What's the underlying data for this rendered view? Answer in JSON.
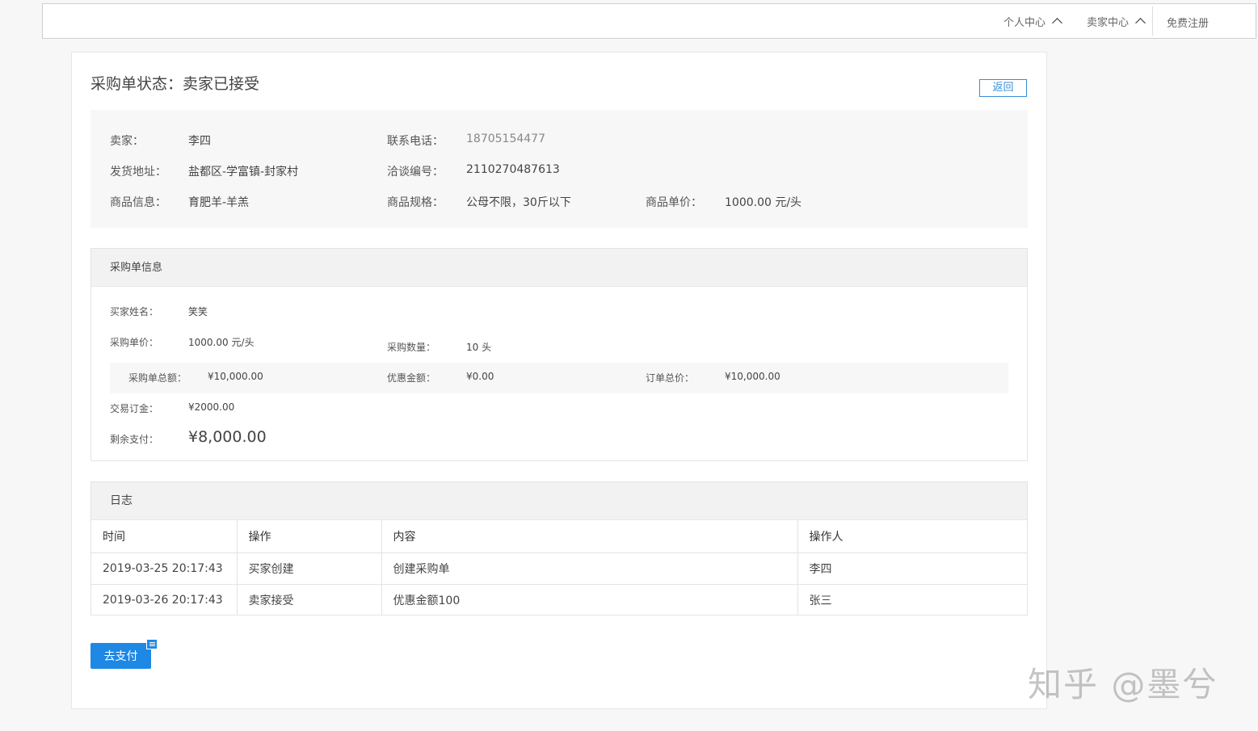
{
  "topnav": {
    "personal_center": "个人中心",
    "seller_center": "卖家中心",
    "register": "免费注册"
  },
  "page": {
    "title": "采购单状态：卖家已接受",
    "back_label": "返回"
  },
  "seller_info": {
    "seller_label": "卖家：",
    "seller_value": "李四",
    "phone_label": "联系电话：",
    "phone_value": "18705154477",
    "address_label": "发货地址：",
    "address_value": "盐都区-学富镇-封家村",
    "negotiation_label": "洽谈编号：",
    "negotiation_value": "2110270487613",
    "product_label": "商品信息：",
    "product_value": "育肥羊-羊羔",
    "spec_label": "商品规格：",
    "spec_value": "公母不限，30斤以下",
    "unit_price_label": "商品单价：",
    "unit_price_value": "1000.00 元/头"
  },
  "order_info": {
    "heading": "采购单信息",
    "buyer_name_label": "买家姓名：",
    "buyer_name_value": "笑笑",
    "purchase_price_label": "采购单价：",
    "purchase_price_value": "1000.00 元/头",
    "quantity_label": "采购数量：",
    "quantity_value": "10 头",
    "total_label": "采购单总额：",
    "total_value": "¥10,000.00",
    "discount_label": "优惠金额：",
    "discount_value": "¥0.00",
    "order_total_label": "订单总价：",
    "order_total_value": "¥10,000.00",
    "deposit_label": "交易订金：",
    "deposit_value": "¥2000.00",
    "remaining_label": "剩余支付：",
    "remaining_value": "¥8,000.00"
  },
  "log": {
    "heading": "日志",
    "columns": [
      "时间",
      "操作",
      "内容",
      "操作人"
    ],
    "rows": [
      [
        "2019-03-25 20:17:43",
        "买家创建",
        "创建采购单",
        "李四"
      ],
      [
        "2019-03-26 20:17:43",
        "卖家接受",
        "优惠金额100",
        "张三"
      ]
    ]
  },
  "actions": {
    "pay_label": "去支付"
  },
  "watermark": "知乎 @墨兮",
  "colors": {
    "accent": "#1e88e5",
    "back_border": "#3a8ed6",
    "panel_head_bg": "#f2f2f2"
  }
}
